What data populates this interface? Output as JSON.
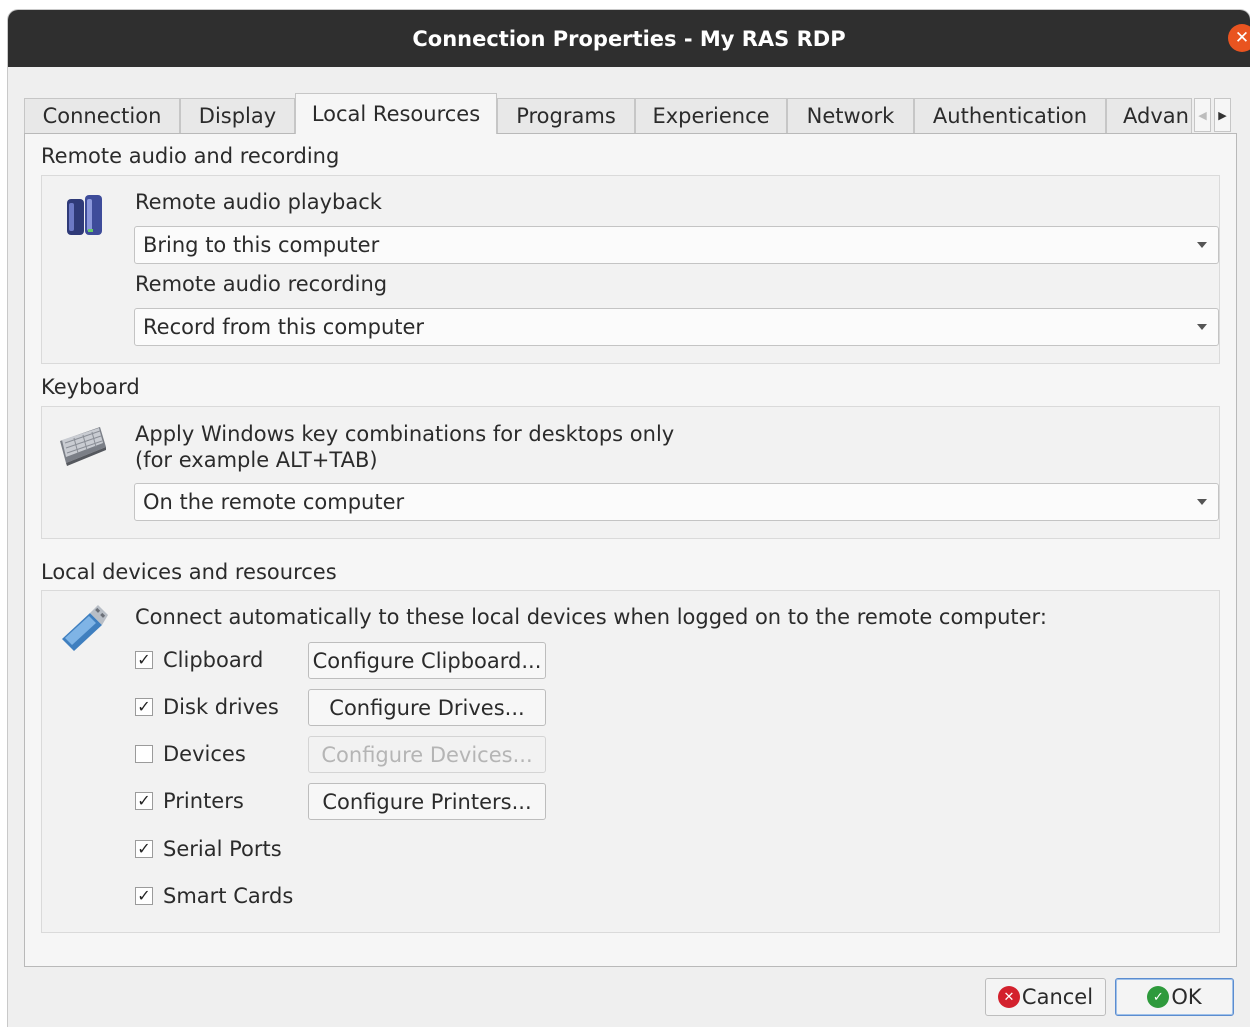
{
  "window": {
    "title": "Connection Properties - My RAS RDP"
  },
  "tabs": [
    {
      "label": "Connection"
    },
    {
      "label": "Display"
    },
    {
      "label": "Local Resources"
    },
    {
      "label": "Programs"
    },
    {
      "label": "Experience"
    },
    {
      "label": "Network"
    },
    {
      "label": "Authentication"
    },
    {
      "label": "Advan"
    }
  ],
  "active_tab": "Local Resources",
  "audio": {
    "section_label": "Remote audio and recording",
    "playback_label": "Remote audio playback",
    "playback_value": "Bring to this computer",
    "recording_label": "Remote audio recording",
    "recording_value": "Record from this computer"
  },
  "keyboard": {
    "section_label": "Keyboard",
    "description_line1": "Apply Windows key combinations for desktops only",
    "description_line2": "(for example ALT+TAB)",
    "value": "On the remote computer"
  },
  "devices": {
    "section_label": "Local devices and resources",
    "intro": "Connect automatically to these local devices when logged on to the remote computer:",
    "items": [
      {
        "label": "Clipboard",
        "checked": true,
        "button": "Configure Clipboard...",
        "button_enabled": true
      },
      {
        "label": "Disk drives",
        "checked": true,
        "button": "Configure Drives...",
        "button_enabled": true
      },
      {
        "label": "Devices",
        "checked": false,
        "button": "Configure Devices...",
        "button_enabled": false
      },
      {
        "label": "Printers",
        "checked": true,
        "button": "Configure Printers...",
        "button_enabled": true
      },
      {
        "label": "Serial Ports",
        "checked": true
      },
      {
        "label": "Smart Cards",
        "checked": true
      }
    ]
  },
  "buttons": {
    "cancel": "Cancel",
    "ok": "OK"
  },
  "colors": {
    "close": "#e95420",
    "cancel_icon": "#d3212d",
    "ok_icon": "#2e9a3c",
    "titlebar": "#2f2f2f"
  }
}
